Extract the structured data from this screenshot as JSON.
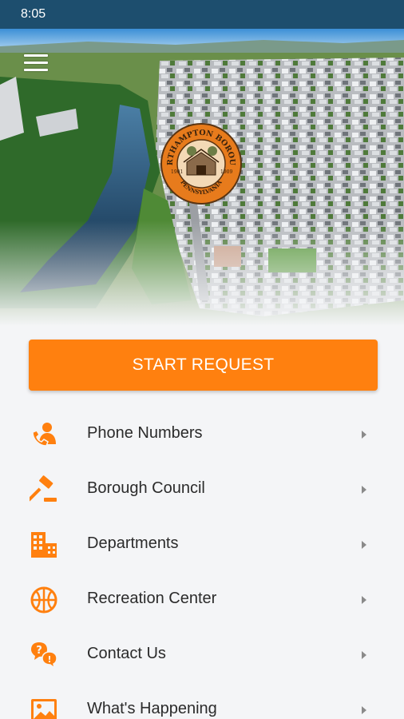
{
  "status_bar": {
    "time": "8:05"
  },
  "header": {
    "menu_icon": "hamburger-menu-icon",
    "seal": {
      "top_text": "NORTHAMPTON BOROUGH",
      "bottom_text": "PENNSYLVANIA",
      "year_left": "1901",
      "year_right": "1909"
    }
  },
  "start_request": {
    "label": "START REQUEST"
  },
  "menu": {
    "items": [
      {
        "label": "Phone Numbers",
        "icon": "phone-contact-icon"
      },
      {
        "label": "Borough Council",
        "icon": "gavel-icon"
      },
      {
        "label": "Departments",
        "icon": "buildings-icon"
      },
      {
        "label": "Recreation Center",
        "icon": "basketball-icon"
      },
      {
        "label": "Contact Us",
        "icon": "chat-question-icon"
      },
      {
        "label": "What's Happening",
        "icon": "image-icon"
      }
    ]
  },
  "colors": {
    "accent": "#ff800f",
    "status_bar": "#1d4e6e",
    "background": "#f4f5f7",
    "text": "#2b2b2b",
    "chevron": "#8a8a8a"
  }
}
